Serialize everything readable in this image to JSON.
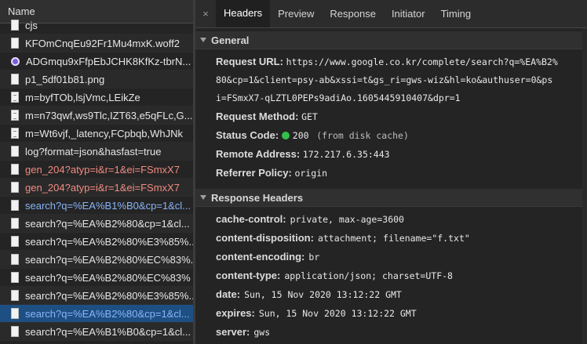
{
  "list": {
    "header": "Name",
    "items": [
      {
        "name": "cjs",
        "icon": "file-icon",
        "style": "normal"
      },
      {
        "name": "KFOmCnqEu92Fr1Mu4mxK.woff2",
        "icon": "file-icon",
        "style": "normal"
      },
      {
        "name": "ADGmqu9xFfpEbJCHK8KfKz-tbrN...",
        "icon": "font-icon",
        "style": "normal"
      },
      {
        "name": "p1_5df01b81.png",
        "icon": "file-icon",
        "style": "normal"
      },
      {
        "name": "m=byfTOb,lsjVmc,LEikZe",
        "icon": "document-icon",
        "style": "normal"
      },
      {
        "name": "m=n73qwf,ws9Tlc,IZT63,e5qFLc,G...",
        "icon": "document-icon",
        "style": "normal"
      },
      {
        "name": "m=Wt6vjf,_latency,FCpbqb,WhJNk",
        "icon": "document-icon",
        "style": "normal"
      },
      {
        "name": "log?format=json&hasfast=true",
        "icon": "file-icon",
        "style": "normal"
      },
      {
        "name": "gen_204?atyp=i&r=1&ei=FSmxX7",
        "icon": "file-icon",
        "style": "error"
      },
      {
        "name": "gen_204?atyp=i&r=1&ei=FSmxX7",
        "icon": "file-icon",
        "style": "error"
      },
      {
        "name": "search?q=%EA%B1%B0&cp=1&cl...",
        "icon": "file-icon",
        "style": "link"
      },
      {
        "name": "search?q=%EA%B2%80&cp=1&cl...",
        "icon": "file-icon",
        "style": "normal"
      },
      {
        "name": "search?q=%EA%B2%80%E3%85%...",
        "icon": "file-icon",
        "style": "normal"
      },
      {
        "name": "search?q=%EA%B2%80%EC%83%...",
        "icon": "file-icon",
        "style": "normal"
      },
      {
        "name": "search?q=%EA%B2%80%EC%83%",
        "icon": "file-icon",
        "style": "normal"
      },
      {
        "name": "search?q=%EA%B2%80%E3%85%...",
        "icon": "file-icon",
        "style": "normal"
      },
      {
        "name": "search?q=%EA%B2%80&cp=1&cl...",
        "icon": "file-icon",
        "style": "link",
        "selected": true
      },
      {
        "name": "search?q=%EA%B1%B0&cp=1&cl...",
        "icon": "file-icon",
        "style": "normal"
      }
    ]
  },
  "tabs": {
    "close": "×",
    "items": [
      "Headers",
      "Preview",
      "Response",
      "Initiator",
      "Timing"
    ],
    "active": "Headers"
  },
  "general": {
    "title": "General",
    "request_url_label": "Request URL:",
    "request_url_lines": [
      "https://www.google.co.kr/complete/search?q=%EA%B2%",
      "80&cp=1&client=psy-ab&xssi=t&gs_ri=gws-wiz&hl=ko&authuser=0&ps",
      "i=FSmxX7-qLZTL0PEPs9adiAo.1605445910407&dpr=1"
    ],
    "request_method_label": "Request Method:",
    "request_method": "GET",
    "status_code_label": "Status Code:",
    "status_code": "200",
    "status_note": "(from disk cache)",
    "remote_address_label": "Remote Address:",
    "remote_address": "172.217.6.35:443",
    "referrer_policy_label": "Referrer Policy:",
    "referrer_policy": "origin"
  },
  "response_headers": {
    "title": "Response Headers",
    "items": [
      {
        "key": "cache-control:",
        "value": "private, max-age=3600"
      },
      {
        "key": "content-disposition:",
        "value": "attachment; filename=\"f.txt\""
      },
      {
        "key": "content-encoding:",
        "value": "br"
      },
      {
        "key": "content-type:",
        "value": "application/json; charset=UTF-8"
      },
      {
        "key": "date:",
        "value": "Sun, 15 Nov 2020 13:12:22 GMT"
      },
      {
        "key": "expires:",
        "value": "Sun, 15 Nov 2020 13:12:22 GMT"
      },
      {
        "key": "server:",
        "value": "gws"
      }
    ]
  },
  "colors": {
    "selected_row": "#1e4f83",
    "error_text": "#f28b82",
    "link_text": "#8ab4f8",
    "status_ok": "#33c04a"
  }
}
